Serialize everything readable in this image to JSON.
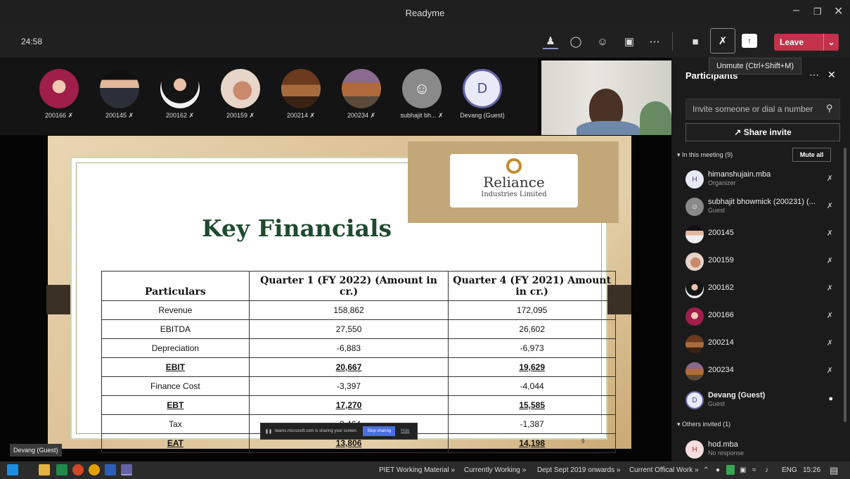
{
  "window": {
    "title": "Readyme"
  },
  "meeting": {
    "timer": "24:58",
    "leave_label": "Leave",
    "tooltip": "Unmute (Ctrl+Shift+M)"
  },
  "thumbnails": [
    {
      "name": "200166"
    },
    {
      "name": "200145"
    },
    {
      "name": "200162"
    },
    {
      "name": "200159"
    },
    {
      "name": "200214"
    },
    {
      "name": "200234"
    },
    {
      "name": "subhajit bh..."
    },
    {
      "name": "Devang (Guest)",
      "initial": "D"
    }
  ],
  "slide": {
    "title": "Key Financials",
    "logo_name": "Reliance",
    "logo_sub": "Industries Limited",
    "headers": [
      "Particulars",
      "Quarter 1 (FY 2022) (Amount in cr.)",
      "Quarter 4 (FY 2021) Amount in cr.)"
    ],
    "rows": [
      {
        "label": "Revenue",
        "q1": "158,862",
        "q4": "172,095",
        "bold": false
      },
      {
        "label": "EBITDA",
        "q1": "27,550",
        "q4": "26,602",
        "bold": false
      },
      {
        "label": "Depreciation",
        "q1": "-6,883",
        "q4": "-6,973",
        "bold": false
      },
      {
        "label": "EBIT",
        "q1": "20,667",
        "q4": "19,629",
        "bold": true
      },
      {
        "label": "Finance Cost",
        "q1": "-3,397",
        "q4": "-4,044",
        "bold": false
      },
      {
        "label": "EBT",
        "q1": "17,270",
        "q4": "15,585",
        "bold": true
      },
      {
        "label": "Tax",
        "q1": "-3,464",
        "q4": "-1,387",
        "bold": false
      },
      {
        "label": "EAT",
        "q1": "13,806",
        "q4": "14,198",
        "bold": true
      }
    ],
    "page_number": "9"
  },
  "share_bar": {
    "message": "teams.microsoft.com is sharing your screen.",
    "stop_label": "Stop sharing",
    "hide_label": "Hide"
  },
  "presenter_label": "Devang (Guest)",
  "panel": {
    "title": "Participants",
    "invite_placeholder": "Invite someone or dial a number",
    "share_invite_label": "Share invite",
    "in_meeting_label": "In this meeting (9)",
    "mute_all_label": "Mute all",
    "others_label": "Others invited (1)",
    "participants": [
      {
        "name": "himanshujain.mba",
        "sub": "Organizer",
        "initial": "H"
      },
      {
        "name": "subhajit bhowmick (200231) (...",
        "sub": "Guest",
        "initial": ""
      },
      {
        "name": "200145",
        "sub": "",
        "initial": ""
      },
      {
        "name": "200159",
        "sub": "",
        "initial": ""
      },
      {
        "name": "200162",
        "sub": "",
        "initial": ""
      },
      {
        "name": "200166",
        "sub": "",
        "initial": ""
      },
      {
        "name": "200214",
        "sub": "",
        "initial": ""
      },
      {
        "name": "200234",
        "sub": "",
        "initial": ""
      },
      {
        "name": "Devang (Guest)",
        "sub": "Guest",
        "initial": "D"
      }
    ],
    "others": [
      {
        "name": "hod.mba",
        "sub": "No response",
        "initial": "H"
      }
    ]
  },
  "taskbar": {
    "items": [
      "PIET Working Material",
      "Currently Working",
      "Dept Sept 2019 onwards",
      "Current Offical Work"
    ],
    "lang": "ENG",
    "time": "15:26"
  },
  "colors": {
    "leave": "#c4314b",
    "accent": "#6264a7",
    "slide_title": "#1e4b2e"
  }
}
